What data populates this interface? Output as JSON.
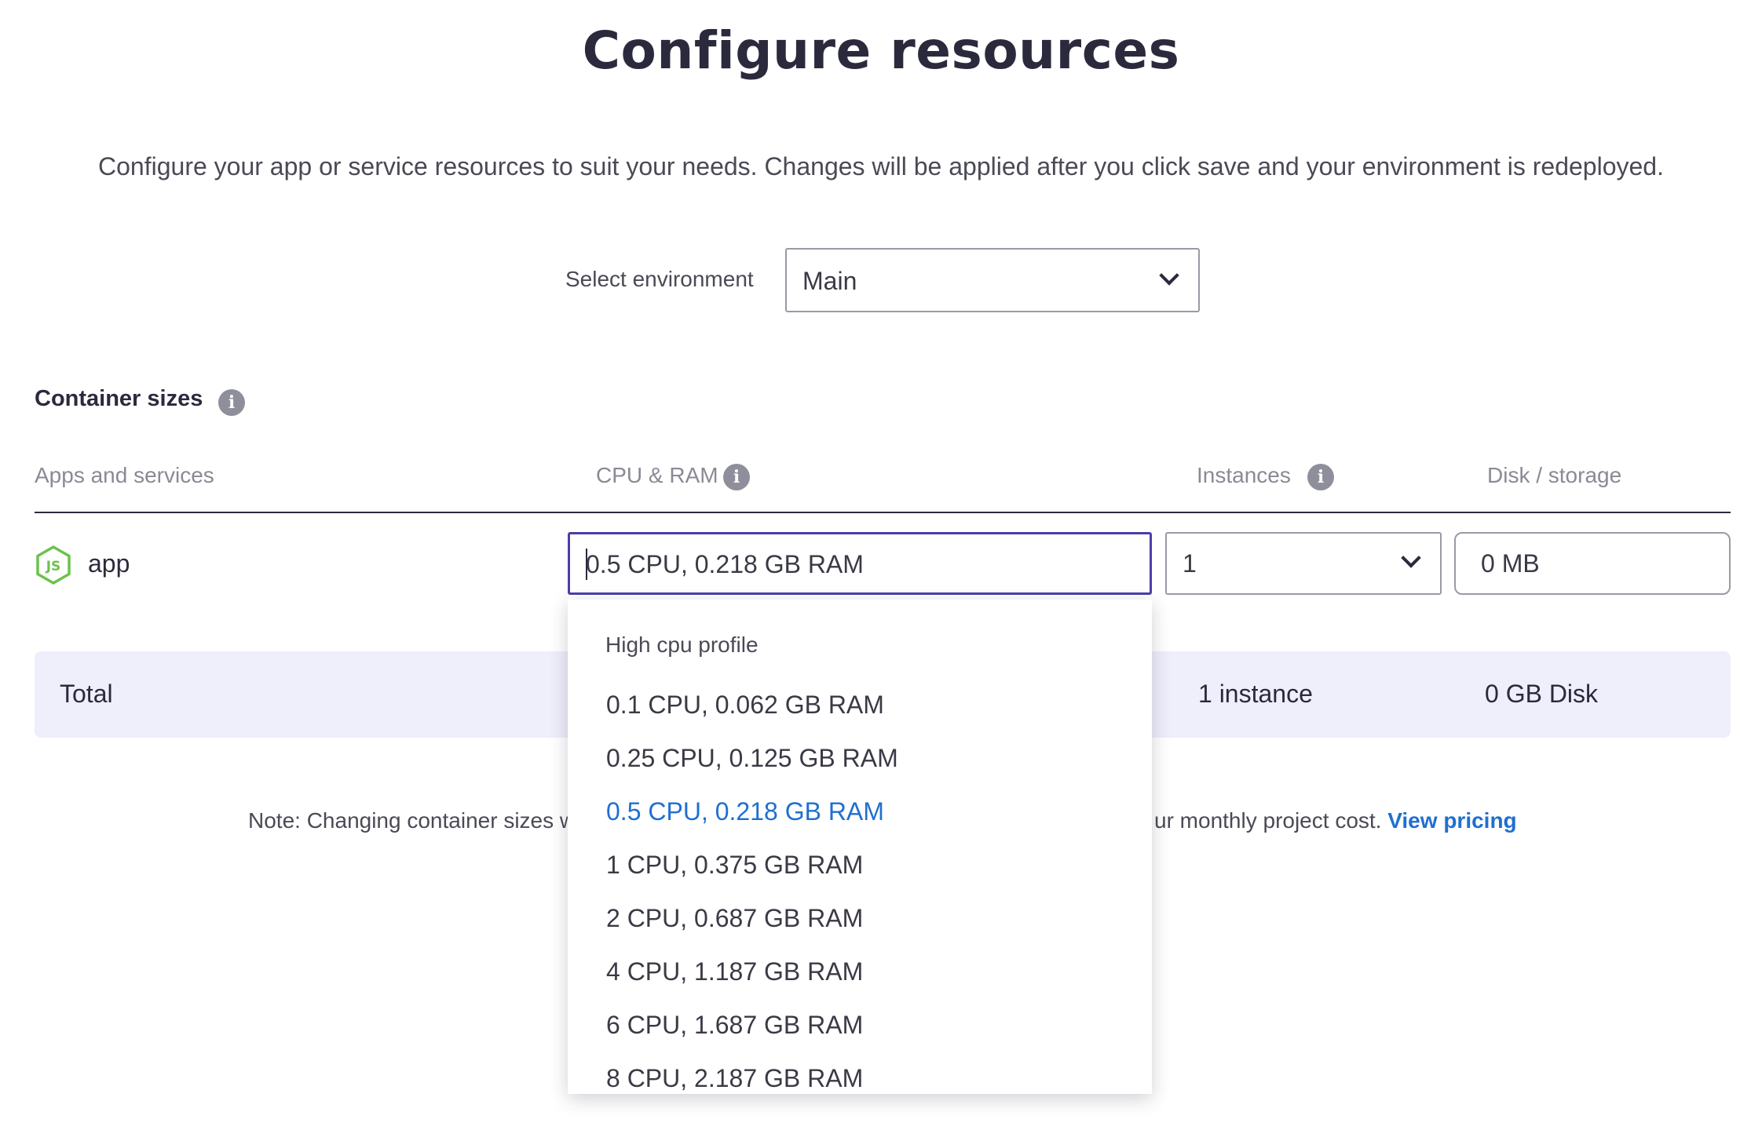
{
  "header": {
    "title": "Configure resources",
    "subtitle": "Configure your app or service resources to suit your needs. Changes will be applied after you click save and your environment is redeployed."
  },
  "environment": {
    "label": "Select environment",
    "selected": "Main"
  },
  "container_sizes": {
    "title": "Container sizes",
    "columns": {
      "apps": "Apps and services",
      "cpu_ram": "CPU & RAM",
      "instances": "Instances",
      "disk": "Disk / storage"
    },
    "row": {
      "app_name": "app",
      "cpu_ram": "0.5 CPU, 0.218 GB RAM",
      "instances": "1",
      "disk": "0 MB"
    },
    "total": {
      "label": "Total",
      "instances": "1 instance",
      "disk": "0 GB Disk"
    }
  },
  "note": {
    "text_a": "Note: Changing container sizes w",
    "text_b": "ur monthly project cost.",
    "link": "View pricing"
  },
  "dropdown": {
    "group_label": "High cpu profile",
    "options": [
      "0.1 CPU, 0.062 GB RAM",
      "0.25 CPU, 0.125 GB RAM",
      "0.5 CPU, 0.218 GB RAM",
      "1 CPU, 0.375 GB RAM",
      "2 CPU, 0.687 GB RAM",
      "4 CPU, 1.187 GB RAM",
      "6 CPU, 1.687 GB RAM",
      "8 CPU, 2.187 GB RAM"
    ],
    "selected_index": 2
  },
  "colors": {
    "accent": "#4a3fa8",
    "link": "#1f6fd1",
    "total_bg": "#efeefb",
    "node_green": "#6cc24a"
  },
  "icons": {
    "info": "info-icon",
    "chevron": "chevron-down-icon",
    "app": "nodejs-icon"
  }
}
